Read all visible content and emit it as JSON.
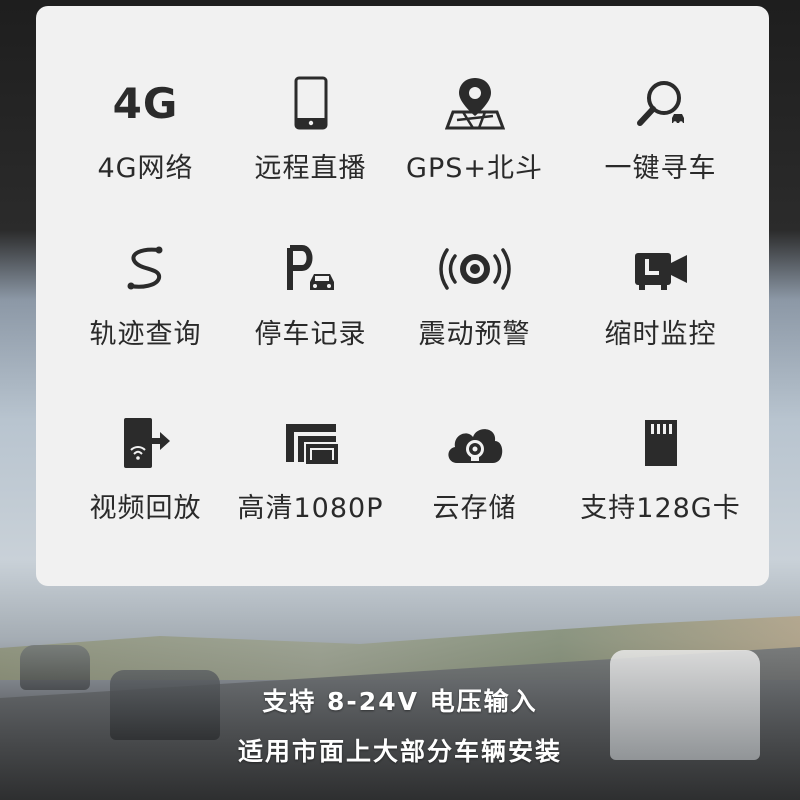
{
  "colors": {
    "card_background": "#f1f1f1",
    "icon": "#2b2b2b",
    "label": "#2a2a2a",
    "caption": "#ffffff"
  },
  "features": [
    {
      "label": "4G网络",
      "icon": "4g-text-icon",
      "icon_text": "4G"
    },
    {
      "label": "远程直播",
      "icon": "smartphone-icon"
    },
    {
      "label": "GPS+北斗",
      "icon": "map-pin-icon"
    },
    {
      "label": "一键寻车",
      "icon": "magnifier-car-icon"
    },
    {
      "label": "轨迹查询",
      "icon": "route-squiggle-icon"
    },
    {
      "label": "停车记录",
      "icon": "parking-car-icon"
    },
    {
      "label": "震动预警",
      "icon": "vibration-icon"
    },
    {
      "label": "缩时监控",
      "icon": "timelapse-camera-icon"
    },
    {
      "label": "视频回放",
      "icon": "phone-playback-icon"
    },
    {
      "label": "高清1080P",
      "icon": "hd-frames-icon"
    },
    {
      "label": "云存储",
      "icon": "cloud-camera-icon"
    },
    {
      "label": "支持128G卡",
      "icon": "sd-card-icon"
    }
  ],
  "caption": {
    "line1": "支持 8-24V 电压输入",
    "line2": "适用市面上大部分车辆安装"
  }
}
